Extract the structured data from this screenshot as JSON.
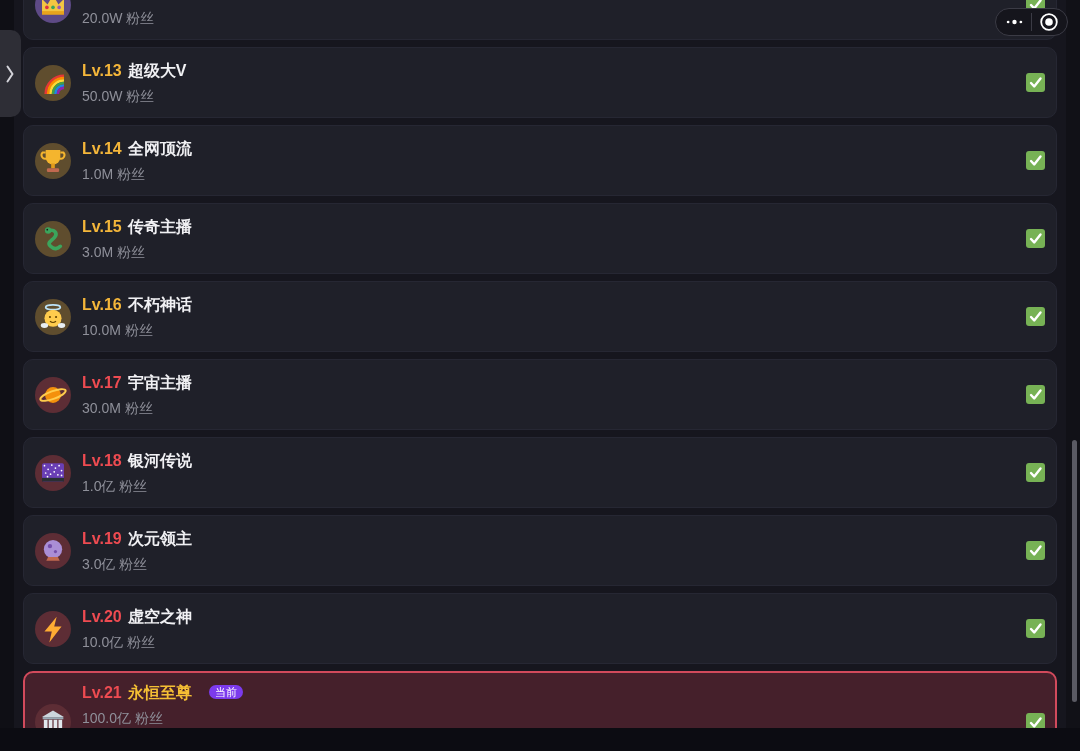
{
  "levels": [
    {
      "followers": "20.0W 粉丝",
      "color": "#5e4a86",
      "checked": true,
      "current": false
    },
    {
      "level": "Lv.13",
      "title": "超级大V",
      "followers": "50.0W 粉丝",
      "color": "#5f4d2e",
      "checked": true,
      "current": false
    },
    {
      "level": "Lv.14",
      "title": "全网顶流",
      "followers": "1.0M 粉丝",
      "color": "#5f4d2e",
      "checked": true,
      "current": false
    },
    {
      "level": "Lv.15",
      "title": "传奇主播",
      "followers": "3.0M 粉丝",
      "color": "#5f4d2e",
      "checked": true,
      "current": false
    },
    {
      "level": "Lv.16",
      "title": "不朽神话",
      "followers": "10.0M 粉丝",
      "color": "#5f4d2e",
      "checked": true,
      "current": false
    },
    {
      "level": "Lv.17",
      "title": "宇宙主播",
      "followers": "30.0M 粉丝",
      "color": "#5d2d35",
      "checked": true,
      "current": false
    },
    {
      "level": "Lv.18",
      "title": "银河传说",
      "followers": "1.0亿 粉丝",
      "color": "#5d2d35",
      "checked": true,
      "current": false
    },
    {
      "level": "Lv.19",
      "title": "次元领主",
      "followers": "3.0亿 粉丝",
      "color": "#5d2d35",
      "checked": true,
      "current": false
    },
    {
      "level": "Lv.20",
      "title": "虚空之神",
      "followers": "10.0亿 粉丝",
      "color": "#5d2d35",
      "checked": true,
      "current": false
    },
    {
      "level": "Lv.21",
      "title": "永恒至尊",
      "badge": "当前",
      "followers": "100.0亿 粉丝",
      "color": "#5d2d35",
      "checked": true,
      "current": true
    }
  ]
}
